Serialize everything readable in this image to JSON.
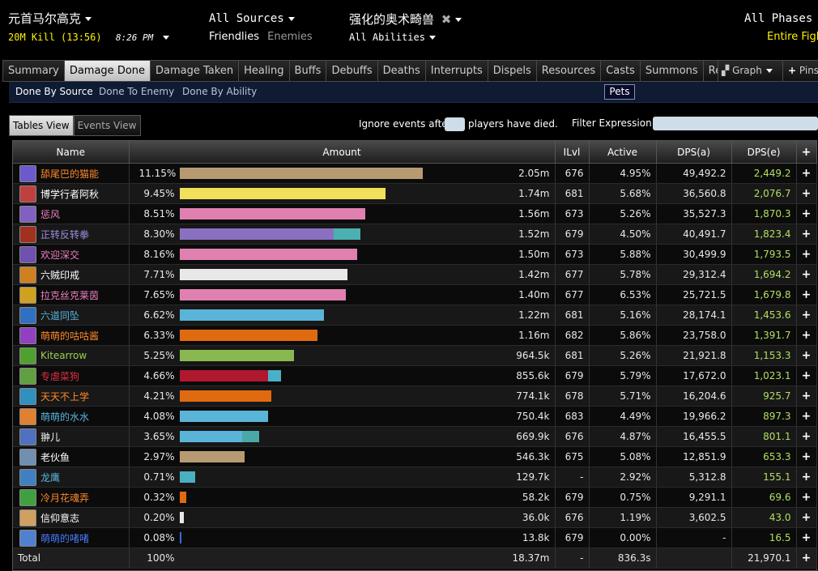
{
  "header": {
    "zone": "元首马尔高克",
    "kill": "20M Kill (13:56)",
    "time": "8:26 PM",
    "sources": "All Sources",
    "friendlies": "Friendlies",
    "enemies": "Enemies",
    "target": "强化的奥术畸兽",
    "abilities": "All Abilities",
    "phases": "All Phases",
    "fight": "Entire Figh"
  },
  "tabs": [
    "Summary",
    "Damage Done",
    "Damage Taken",
    "Healing",
    "Buffs",
    "Debuffs",
    "Deaths",
    "Interrupts",
    "Dispels",
    "Resources",
    "Casts",
    "Summons",
    "Replay"
  ],
  "active_tab": "Damage Done",
  "graph_label": "Graph",
  "pins_label": "Pins",
  "subtabs": [
    "Done By Source",
    "Done To Enemy",
    "Done By Ability"
  ],
  "pets_label": "Pets",
  "views": {
    "tables": "Tables View",
    "events": "Events View"
  },
  "ignore": {
    "before": "Ignore events after",
    "after": "players have died."
  },
  "filter_label": "Filter Expression:",
  "columns": {
    "name": "Name",
    "amount": "Amount",
    "ilvl": "ILvl",
    "active": "Active",
    "dps_a": "DPS(a)",
    "dps_e": "DPS(e)",
    "plus": "+"
  },
  "rows": [
    {
      "name": "舔尾巴的猫能",
      "color": "#ff8a2a",
      "icon": "#6a5acd",
      "pct": "11.15%",
      "amount": "2.05m",
      "ilvl": "676",
      "active": "4.95%",
      "dps_a": "49,492.2",
      "dps_e": "2,449.2",
      "bar": [
        {
          "w": 300,
          "c": "#b89a72"
        }
      ]
    },
    {
      "name": "博学行者阿秋",
      "color": "#ffffff",
      "icon": "#c04040",
      "pct": "9.45%",
      "amount": "1.74m",
      "ilvl": "681",
      "active": "5.68%",
      "dps_a": "36,560.8",
      "dps_e": "2,076.7",
      "bar": [
        {
          "w": 254,
          "c": "#f0e05a"
        }
      ]
    },
    {
      "name": "惩风",
      "color": "#f080c0",
      "icon": "#8060c0",
      "pct": "8.51%",
      "amount": "1.56m",
      "ilvl": "673",
      "active": "5.26%",
      "dps_a": "35,527.3",
      "dps_e": "1,870.3",
      "bar": [
        {
          "w": 229,
          "c": "#e080b0"
        }
      ]
    },
    {
      "name": "正转反转拳",
      "color": "#9a8ee0",
      "icon": "#a03020",
      "pct": "8.30%",
      "amount": "1.52m",
      "ilvl": "679",
      "active": "4.50%",
      "dps_a": "40,491.7",
      "dps_e": "1,823.4",
      "bar": [
        {
          "w": 190,
          "c": "#8a70c0"
        },
        {
          "w": 33,
          "c": "#4ab0b0"
        }
      ]
    },
    {
      "name": "欢迎深交",
      "color": "#f080c0",
      "icon": "#7050b0",
      "pct": "8.16%",
      "amount": "1.50m",
      "ilvl": "673",
      "active": "5.88%",
      "dps_a": "30,499.9",
      "dps_e": "1,793.5",
      "bar": [
        {
          "w": 219,
          "c": "#e080b0"
        }
      ]
    },
    {
      "name": "六贼印戒",
      "color": "#ffffff",
      "icon": "#d08020",
      "pct": "7.71%",
      "amount": "1.42m",
      "ilvl": "677",
      "active": "5.78%",
      "dps_a": "29,312.4",
      "dps_e": "1,694.2",
      "bar": [
        {
          "w": 207,
          "c": "#e8e8e8"
        }
      ]
    },
    {
      "name": "拉克丝克莱茵",
      "color": "#f080c0",
      "icon": "#d0a020",
      "pct": "7.65%",
      "amount": "1.40m",
      "ilvl": "677",
      "active": "6.53%",
      "dps_a": "25,721.5",
      "dps_e": "1,679.8",
      "bar": [
        {
          "w": 205,
          "c": "#e080b0"
        }
      ]
    },
    {
      "name": "六道同坠",
      "color": "#5ab4e0",
      "icon": "#3070c0",
      "pct": "6.62%",
      "amount": "1.22m",
      "ilvl": "681",
      "active": "5.16%",
      "dps_a": "28,174.1",
      "dps_e": "1,453.6",
      "bar": [
        {
          "w": 178,
          "c": "#5ab4d8"
        }
      ]
    },
    {
      "name": "萌萌的咕咕酱",
      "color": "#ff8a2a",
      "icon": "#9040c0",
      "pct": "6.33%",
      "amount": "1.16m",
      "ilvl": "682",
      "active": "5.86%",
      "dps_a": "23,758.0",
      "dps_e": "1,391.7",
      "bar": [
        {
          "w": 170,
          "c": "#e06a10"
        }
      ]
    },
    {
      "name": "Kitearrow",
      "color": "#9ad050",
      "icon": "#50a030",
      "pct": "5.25%",
      "amount": "964.5k",
      "ilvl": "681",
      "active": "5.26%",
      "dps_a": "21,921.8",
      "dps_e": "1,153.3",
      "bar": [
        {
          "w": 141,
          "c": "#8ab850"
        }
      ]
    },
    {
      "name": "专虐菜狗",
      "color": "#e03040",
      "icon": "#60a040",
      "pct": "4.66%",
      "amount": "855.6k",
      "ilvl": "679",
      "active": "5.79%",
      "dps_a": "17,672.0",
      "dps_e": "1,023.1",
      "bar": [
        {
          "w": 109,
          "c": "#b01830"
        },
        {
          "w": 16,
          "c": "#4ab0c8"
        }
      ]
    },
    {
      "name": "天天不上学",
      "color": "#ff8a2a",
      "icon": "#3090c0",
      "pct": "4.21%",
      "amount": "774.1k",
      "ilvl": "678",
      "active": "5.71%",
      "dps_a": "16,204.6",
      "dps_e": "925.7",
      "bar": [
        {
          "w": 113,
          "c": "#e06a10"
        }
      ]
    },
    {
      "name": "萌萌的水水",
      "color": "#5ab4e0",
      "icon": "#e08030",
      "pct": "4.08%",
      "amount": "750.4k",
      "ilvl": "683",
      "active": "4.49%",
      "dps_a": "19,966.2",
      "dps_e": "897.3",
      "bar": [
        {
          "w": 109,
          "c": "#5ab4d8"
        }
      ]
    },
    {
      "name": "翀儿",
      "color": "#ffffff",
      "icon": "#5070c0",
      "pct": "3.65%",
      "amount": "669.9k",
      "ilvl": "676",
      "active": "4.87%",
      "dps_a": "16,455.5",
      "dps_e": "801.1",
      "bar": [
        {
          "w": 77,
          "c": "#5ab4d8"
        },
        {
          "w": 21,
          "c": "#4aa8a8"
        }
      ]
    },
    {
      "name": "老伙鱼",
      "color": "#ffffff",
      "icon": "#7090b0",
      "pct": "2.97%",
      "amount": "546.3k",
      "ilvl": "675",
      "active": "5.08%",
      "dps_a": "12,851.9",
      "dps_e": "653.3",
      "bar": [
        {
          "w": 80,
          "c": "#b89a72"
        }
      ]
    },
    {
      "name": "龙鹰",
      "color": "#5ab4e0",
      "icon": "#4080c0",
      "pct": "0.71%",
      "amount": "129.7k",
      "ilvl": "-",
      "active": "2.92%",
      "dps_a": "5,312.8",
      "dps_e": "155.1",
      "bar": [
        {
          "w": 19,
          "c": "#4ab0c0"
        }
      ]
    },
    {
      "name": "冷月花魂弄",
      "color": "#ff8a2a",
      "icon": "#40a040",
      "pct": "0.32%",
      "amount": "58.2k",
      "ilvl": "679",
      "active": "0.75%",
      "dps_a": "9,291.1",
      "dps_e": "69.6",
      "bar": [
        {
          "w": 8,
          "c": "#e06a10"
        }
      ]
    },
    {
      "name": "信仰意志",
      "color": "#ffffff",
      "icon": "#d0a060",
      "pct": "0.20%",
      "amount": "36.0k",
      "ilvl": "676",
      "active": "1.19%",
      "dps_a": "3,602.5",
      "dps_e": "43.0",
      "bar": [
        {
          "w": 5,
          "c": "#e8e8e8"
        }
      ]
    },
    {
      "name": "萌萌的啫啫",
      "color": "#4a7aff",
      "icon": "#5080d0",
      "pct": "0.08%",
      "amount": "13.8k",
      "ilvl": "679",
      "active": "0.00%",
      "dps_a": "-",
      "dps_e": "16.5",
      "bar": [
        {
          "w": 2,
          "c": "#3a6ae0"
        }
      ]
    }
  ],
  "total": {
    "label": "Total",
    "pct": "100%",
    "amount": "18.37m",
    "ilvl": "-",
    "active": "836.3s",
    "dps_a": "",
    "dps_e": "21,970.1"
  }
}
